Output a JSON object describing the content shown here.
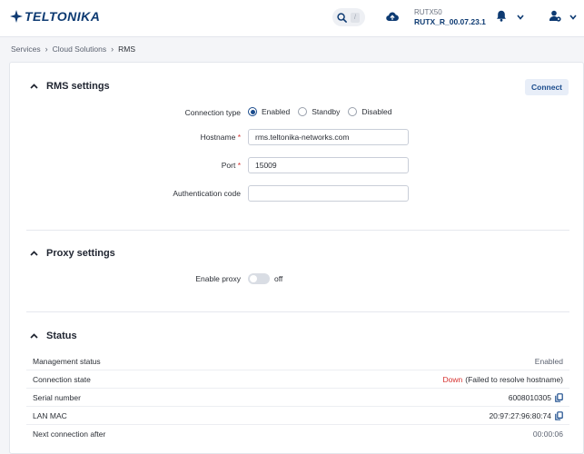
{
  "header": {
    "brand": "TELTONIKA",
    "search_shortcut": "/",
    "device_model": "RUTX50",
    "firmware": "RUTX_R_00.07.23.1"
  },
  "breadcrumb": [
    "Services",
    "Cloud Solutions",
    "RMS"
  ],
  "rms_settings": {
    "title": "RMS settings",
    "connect_label": "Connect",
    "connection_type_label": "Connection type",
    "connection_options": [
      "Enabled",
      "Standby",
      "Disabled"
    ],
    "connection_selected": "Enabled",
    "hostname_label": "Hostname",
    "hostname_value": "rms.teltonika-networks.com",
    "port_label": "Port",
    "port_value": "15009",
    "auth_label": "Authentication code",
    "auth_value": "",
    "required_mark": "*"
  },
  "proxy_settings": {
    "title": "Proxy settings",
    "enable_label": "Enable proxy",
    "enable_state": "off"
  },
  "status": {
    "title": "Status",
    "rows": [
      {
        "label": "Management status",
        "value": "Enabled"
      },
      {
        "label": "Connection state",
        "state": "Down",
        "detail": "(Failed to resolve hostname)"
      },
      {
        "label": "Serial number",
        "value": "6008010305"
      },
      {
        "label": "LAN MAC",
        "value": "20:97:27:96:80:74"
      },
      {
        "label": "Next connection after",
        "value": "00:00:06"
      }
    ]
  },
  "colors": {
    "brand": "#0d3a72",
    "accent": "#1a4b8c",
    "error": "#d6312f"
  },
  "icons": [
    "search-icon",
    "upload-cloud-icon",
    "bell-icon",
    "chevron-down-icon",
    "user-settings-icon",
    "chevron-up-icon",
    "copy-icon"
  ]
}
